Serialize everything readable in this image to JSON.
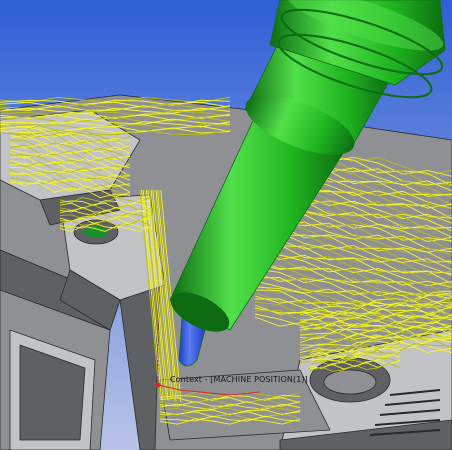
{
  "viewport": {
    "background_top": "#2f5fd6",
    "background_bottom": "#b9c3e6"
  },
  "part": {
    "face_color": "#8f9094",
    "face_light": "#c2c3c6",
    "face_dark": "#5e6064",
    "edge_color": "#2a2a2a"
  },
  "toolpath": {
    "color": "#f4f52a",
    "shade": "#b8bd1c"
  },
  "tool": {
    "holder_color": "#1fb51f",
    "holder_light": "#52e04a",
    "holder_dark": "#0d6c12",
    "cutter_color": "#1a3fc8",
    "cutter_light": "#5c7cf0"
  },
  "context": {
    "label": "Context - [MACHINE POSITION(1)]",
    "marker_color": "#d8262e"
  }
}
